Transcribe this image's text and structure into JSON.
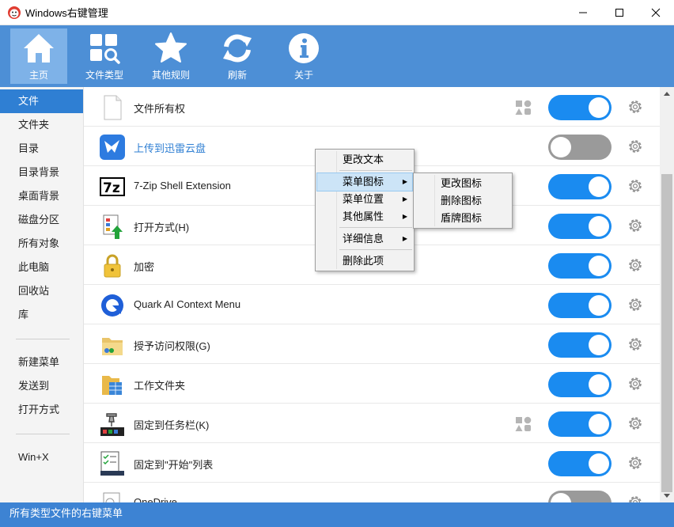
{
  "window": {
    "title": "Windows右键管理"
  },
  "toolbar": {
    "items": [
      {
        "label": "主页",
        "icon": "home-icon"
      },
      {
        "label": "文件类型",
        "icon": "file-types-icon"
      },
      {
        "label": "其他规则",
        "icon": "star-icon"
      },
      {
        "label": "刷新",
        "icon": "refresh-icon"
      },
      {
        "label": "关于",
        "icon": "info-icon"
      }
    ]
  },
  "sidebar": {
    "items": [
      "文件",
      "文件夹",
      "目录",
      "目录背景",
      "桌面背景",
      "磁盘分区",
      "所有对象",
      "此电脑",
      "回收站",
      "库"
    ],
    "items2": [
      "新建菜单",
      "发送到",
      "打开方式"
    ],
    "items3": [
      "Win+X"
    ]
  },
  "list": {
    "rows": [
      {
        "text": "文件所有权",
        "icon": "blank-file-icon",
        "enabled": true
      },
      {
        "text": "上传到迅雷云盘",
        "icon": "thunder-bird-icon",
        "enabled": false
      },
      {
        "text": "7-Zip Shell Extension",
        "icon": "7zip-icon",
        "enabled": true
      },
      {
        "text": "打开方式(H)",
        "icon": "open-with-icon",
        "enabled": true
      },
      {
        "text": "加密",
        "icon": "lock-icon",
        "enabled": true
      },
      {
        "text": "Quark AI Context Menu",
        "icon": "quark-icon",
        "enabled": true
      },
      {
        "text": "授予访问权限(G)",
        "icon": "share-access-icon",
        "enabled": true
      },
      {
        "text": "工作文件夹",
        "icon": "work-folders-icon",
        "enabled": true
      },
      {
        "text": "固定到任务栏(K)",
        "icon": "pin-taskbar-icon",
        "enabled": true
      },
      {
        "text": "固定到\"开始\"列表",
        "icon": "pin-start-icon",
        "enabled": true
      },
      {
        "text": "OneDrive",
        "icon": "onedrive-icon",
        "enabled": false
      }
    ]
  },
  "context_menu": {
    "items": [
      "更改文本",
      "菜单图标",
      "菜单位置",
      "其他属性",
      "详细信息",
      "删除此项"
    ],
    "highlighted": "菜单图标"
  },
  "submenu": {
    "items": [
      "更改图标",
      "删除图标",
      "盾牌图标"
    ]
  },
  "statusbar": {
    "text": "所有类型文件的右键菜单"
  },
  "colors": {
    "toolbar": "#4d8fd6",
    "toggle_on": "#1a8bf0",
    "toggle_off": "#9a9a9a",
    "sidebar_active": "#2f7fd3",
    "statusbar": "#3d83d3"
  }
}
